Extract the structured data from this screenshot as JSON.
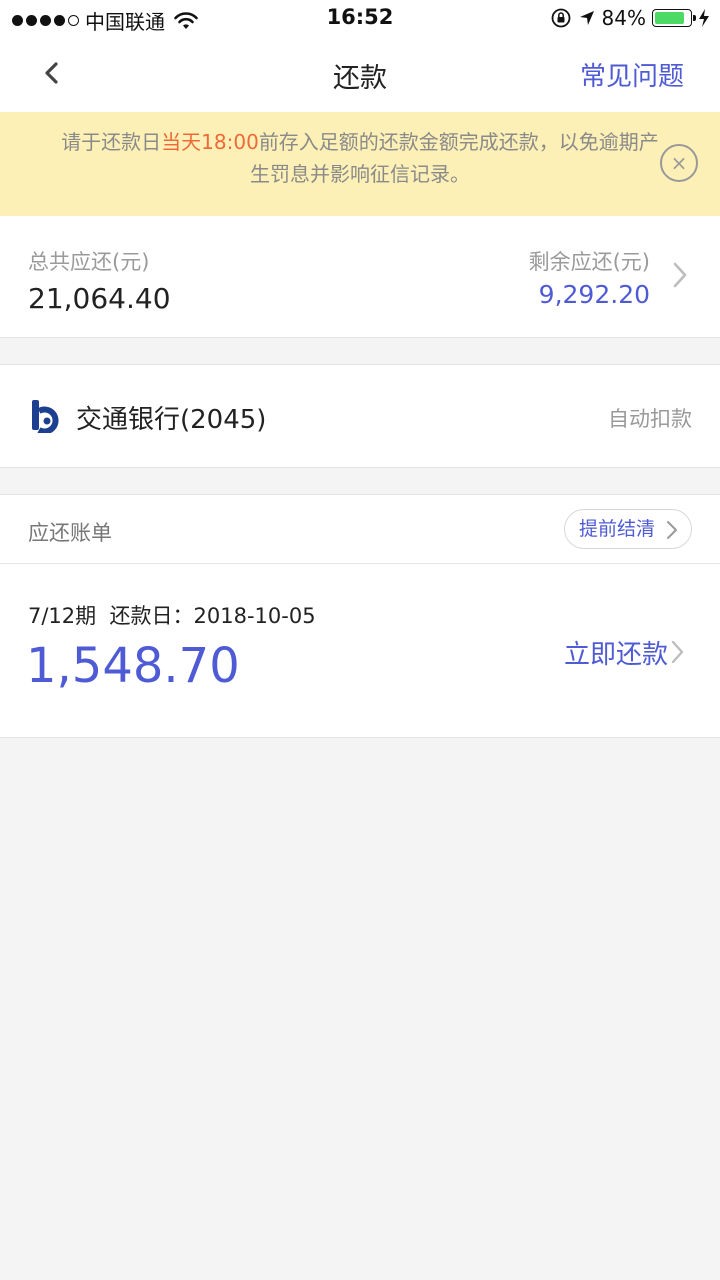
{
  "status_bar": {
    "carrier": "中国联通",
    "time": "16:52",
    "battery": "84%",
    "battery_level": 0.84
  },
  "nav": {
    "title": "还款",
    "faq": "常见问题"
  },
  "notice": {
    "text_before": "请于还款日",
    "highlight": "当天18:00",
    "text_after": "前存入足额的还款金额完成还款，以免逾期产生罚息并影响征信记录。",
    "close_symbol": "×"
  },
  "summary": {
    "total_label": "总共应还(元)",
    "total_value": "21,064.40",
    "remaining_label": "剩余应还(元)",
    "remaining_value": "9,292.20"
  },
  "bank": {
    "name": "交通银行(2045)",
    "auto_debit": "自动扣款"
  },
  "bills": {
    "title": "应还账单",
    "payoff_button": "提前结清",
    "item": {
      "period": "7/12期",
      "due_label": "还款日：",
      "due_date": "2018-10-05",
      "amount": "1,548.70",
      "pay_now": "立即还款"
    }
  },
  "colors": {
    "accent": "#4f5bd5",
    "notice_bg": "#fdf0b6",
    "notice_highlight": "#ee6a3a",
    "battery": "#4cd964"
  },
  "icons": {
    "back": "chevron-left-icon",
    "close": "close-circle-icon",
    "forward": "chevron-right-icon",
    "bank_logo": "bocom-logo-icon"
  }
}
